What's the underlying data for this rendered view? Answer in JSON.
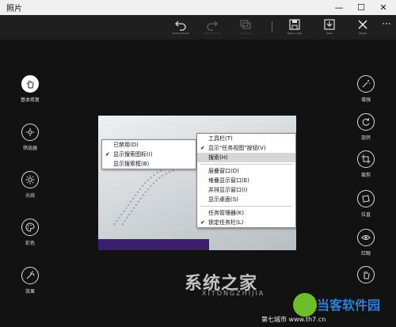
{
  "app": {
    "title": "照片"
  },
  "window_controls": {
    "minimize": "—",
    "maximize": "☐",
    "close": "✕"
  },
  "toolbar": {
    "undo_label": "Undo (Ctrl+Z)",
    "redo_label": "Redo (Ctrl+Y)",
    "compare_label": "Compare",
    "save_copy_label": "Save a copy",
    "save_label": "Save",
    "cancel_label": "Cancel"
  },
  "left_tools": [
    {
      "label": "基本修复",
      "icon": "hand-icon",
      "active": true
    },
    {
      "label": "筛选器",
      "icon": "filter-icon",
      "active": false
    },
    {
      "label": "光线",
      "icon": "sun-icon",
      "active": false
    },
    {
      "label": "彩色",
      "icon": "palette-icon",
      "active": false
    },
    {
      "label": "效果",
      "icon": "effects-icon",
      "active": false
    }
  ],
  "right_tools": [
    {
      "label": "增强",
      "icon": "wand-icon"
    },
    {
      "label": "旋转",
      "icon": "rotate-icon"
    },
    {
      "label": "裁剪",
      "icon": "crop-icon"
    },
    {
      "label": "拉直",
      "icon": "straighten-icon"
    },
    {
      "label": "红眼",
      "icon": "eye-icon"
    },
    {
      "label": "",
      "icon": "hand-icon"
    }
  ],
  "photo": {
    "menu_left": [
      {
        "label": "已禁用(D)",
        "checked": false
      },
      {
        "label": "显示搜索图标(I)",
        "checked": true
      },
      {
        "label": "显示搜索框(B)",
        "checked": false
      }
    ],
    "menu_right": [
      {
        "label": "工具栏(T)",
        "checked": false
      },
      {
        "label": "显示\"任务视图\"按钮(V)",
        "checked": true
      },
      {
        "label": "搜索(H)",
        "checked": false,
        "highlight": true
      },
      {
        "label": "层叠窗口(D)",
        "checked": false
      },
      {
        "label": "堆叠显示窗口(E)",
        "checked": false
      },
      {
        "label": "并排显示窗口(I)",
        "checked": false
      },
      {
        "label": "显示桌面(S)",
        "checked": false
      },
      {
        "label": "任务管理器(K)",
        "checked": false
      },
      {
        "label": "锁定任务栏(L)",
        "checked": true
      }
    ]
  },
  "watermark": {
    "main": "系统之家",
    "sub": "XITONGZHIJIA",
    "brand": "当客软件园",
    "url": "第七城市  www.th7.cn"
  }
}
